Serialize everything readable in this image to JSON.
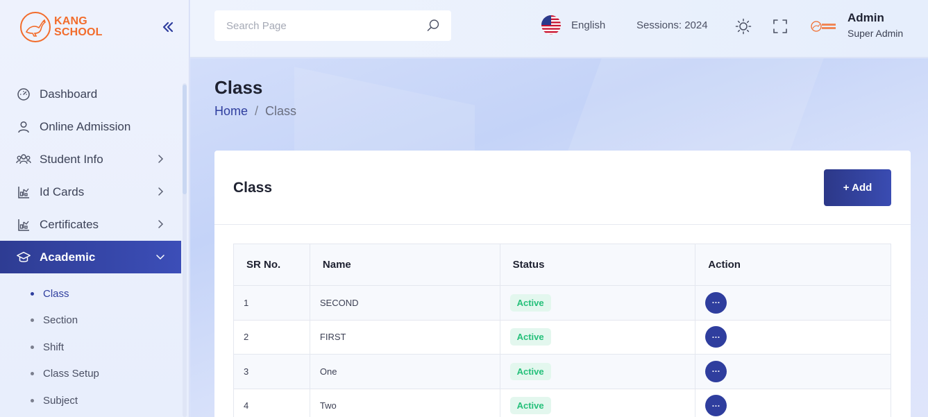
{
  "brand": {
    "line1": "KANG",
    "line2": "SCHOOL",
    "color": "#f26c2b"
  },
  "sidebar": {
    "items": [
      {
        "label": "Dashboard",
        "icon": "gauge-icon"
      },
      {
        "label": "Online Admission",
        "icon": "user-icon"
      },
      {
        "label": "Student Info",
        "icon": "users-icon"
      },
      {
        "label": "Id Cards",
        "icon": "chart-icon"
      },
      {
        "label": "Certificates",
        "icon": "chart-icon"
      },
      {
        "label": "Academic",
        "icon": "graduation-cap-icon"
      }
    ],
    "submenu": [
      "Class",
      "Section",
      "Shift",
      "Class Setup",
      "Subject"
    ]
  },
  "topbar": {
    "search_placeholder": "Search Page",
    "language": "English",
    "sessions": "Sessions: 2024",
    "user_name": "Admin",
    "user_role": "Super Admin"
  },
  "page": {
    "title": "Class",
    "breadcrumb_home": "Home",
    "breadcrumb_sep": "/",
    "breadcrumb_current": "Class"
  },
  "card": {
    "title": "Class",
    "add_label": "+ Add",
    "columns": [
      "SR No.",
      "Name",
      "Status",
      "Action"
    ],
    "rows": [
      {
        "sr": "1",
        "name": "SECOND",
        "status": "Active",
        "action": "···"
      },
      {
        "sr": "2",
        "name": "FIRST",
        "status": "Active",
        "action": "···"
      },
      {
        "sr": "3",
        "name": "One",
        "status": "Active",
        "action": "···"
      },
      {
        "sr": "4",
        "name": "Two",
        "status": "Active",
        "action": "···"
      }
    ]
  },
  "colors": {
    "primary": "#2f3e9e",
    "success": "#25c07a"
  }
}
